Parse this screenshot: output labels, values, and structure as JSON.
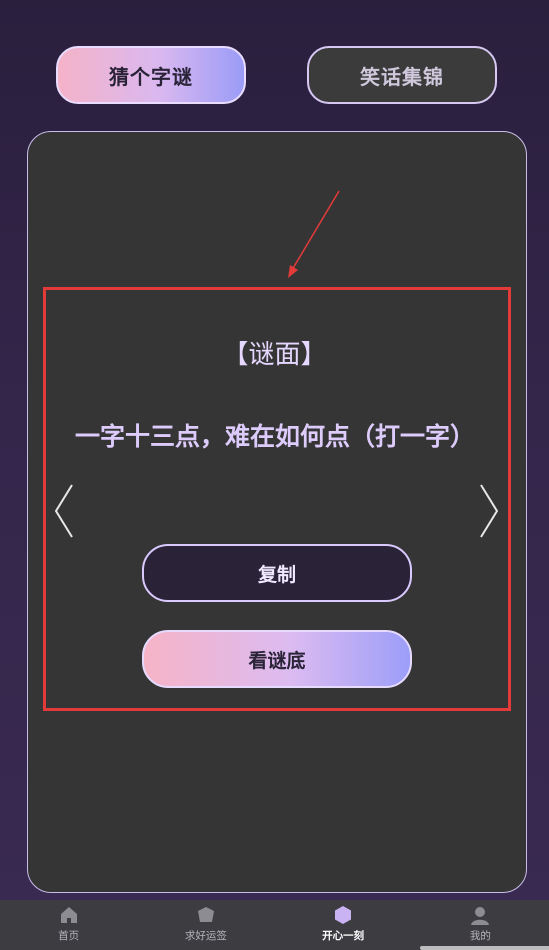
{
  "tabs": [
    {
      "label": "猜个字谜",
      "active": true
    },
    {
      "label": "笑话集锦",
      "active": false
    }
  ],
  "riddle": {
    "heading": "【谜面】",
    "text": "一字十三点，难在如何点（打一字）"
  },
  "buttons": {
    "copy_label": "复制",
    "answer_label": "看谜底"
  },
  "bottom_nav": [
    {
      "label": "首页",
      "icon": "home-icon",
      "active": false
    },
    {
      "label": "求好运签",
      "icon": "pentagon-icon",
      "active": false
    },
    {
      "label": "开心一刻",
      "icon": "hexagon-icon",
      "active": true
    },
    {
      "label": "我的",
      "icon": "user-icon",
      "active": false
    }
  ],
  "colors": {
    "accent_gradient_start": "#f5b3c8",
    "accent_gradient_end": "#9b9cf7",
    "annotation_red": "#e33a3a",
    "riddle_text": "#dccbfb"
  }
}
